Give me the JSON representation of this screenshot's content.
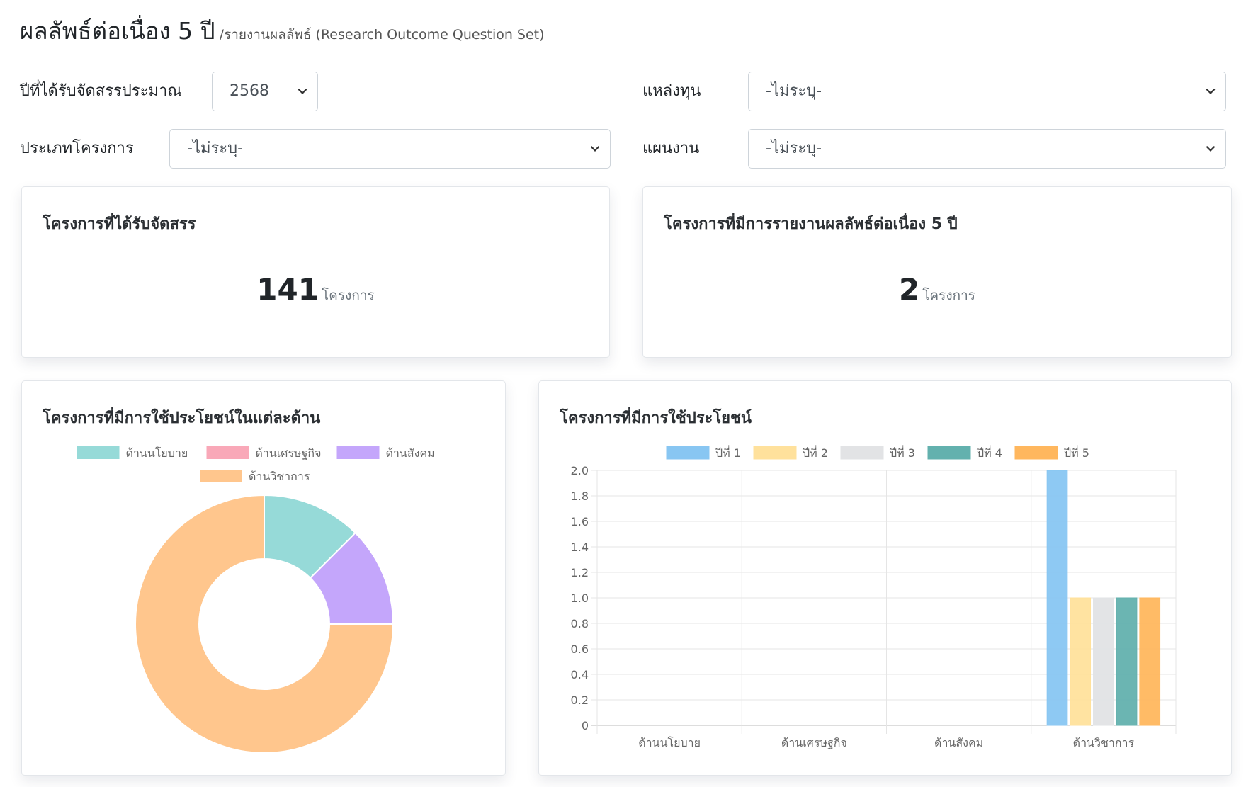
{
  "header": {
    "title": "ผลลัพธ์ต่อเนื่อง 5 ปี",
    "subtitle": "/รายงานผลลัพธ์ (Research Outcome Question Set)"
  },
  "filters": {
    "budget_year_label": "ปีที่ได้รับจัดสรรประมาณ",
    "budget_year_value": "2568",
    "funding_source_label": "แหล่งทุน",
    "funding_source_value": "-ไม่ระบุ-",
    "project_type_label": "ประเภทโครงการ",
    "project_type_value": "-ไม่ระบุ-",
    "plan_label": "แผนงาน",
    "plan_value": "-ไม่ระบุ-"
  },
  "stats": {
    "allocated_title": "โครงการที่ได้รับจัดสรร",
    "allocated_value": "141",
    "allocated_unit": "โครงการ",
    "reported_title": "โครงการที่มีการรายงานผลลัพธ์ต่อเนื่อง 5 ปี",
    "reported_value": "2",
    "reported_unit": "โครงการ"
  },
  "colors": {
    "policy": "#96DAD8",
    "economic": "#F9A8B8",
    "social": "#C4A6FB",
    "academic": "#FFC68D",
    "year1": "#88C6F2",
    "year2": "#FFE19C",
    "year3": "#E2E3E5",
    "year4": "#63B1AE",
    "year5": "#FFB75E"
  },
  "chart_data": [
    {
      "type": "pie",
      "variant": "doughnut",
      "title": "โครงการที่มีการใช้ประโยชน์ในแต่ละด้าน",
      "legend_position": "top",
      "categories": [
        "ด้านนโยบาย",
        "ด้านเศรษฐกิจ",
        "ด้านสังคม",
        "ด้านวิชาการ"
      ],
      "values": [
        1,
        0,
        1,
        6
      ],
      "colors": [
        "#96DAD8",
        "#F9A8B8",
        "#C4A6FB",
        "#FFC68D"
      ]
    },
    {
      "type": "bar",
      "title": "โครงการที่มีการใช้ประโยชน์",
      "legend_position": "top",
      "categories": [
        "ด้านนโยบาย",
        "ด้านเศรษฐกิจ",
        "ด้านสังคม",
        "ด้านวิชาการ"
      ],
      "series": [
        {
          "name": "ปีที่ 1",
          "values": [
            0,
            0,
            0,
            2
          ],
          "color": "#88C6F2"
        },
        {
          "name": "ปีที่ 2",
          "values": [
            0,
            0,
            0,
            1
          ],
          "color": "#FFE19C"
        },
        {
          "name": "ปีที่ 3",
          "values": [
            0,
            0,
            0,
            1
          ],
          "color": "#E2E3E5"
        },
        {
          "name": "ปีที่ 4",
          "values": [
            0,
            0,
            0,
            1
          ],
          "color": "#63B1AE"
        },
        {
          "name": "ปีที่ 5",
          "values": [
            0,
            0,
            0,
            1
          ],
          "color": "#FFB75E"
        }
      ],
      "ylim": [
        0,
        2.0
      ],
      "yticks": [
        "0",
        "0.2",
        "0.4",
        "0.6",
        "0.8",
        "1.0",
        "1.2",
        "1.4",
        "1.6",
        "1.8",
        "2.0"
      ],
      "grid": true
    }
  ]
}
